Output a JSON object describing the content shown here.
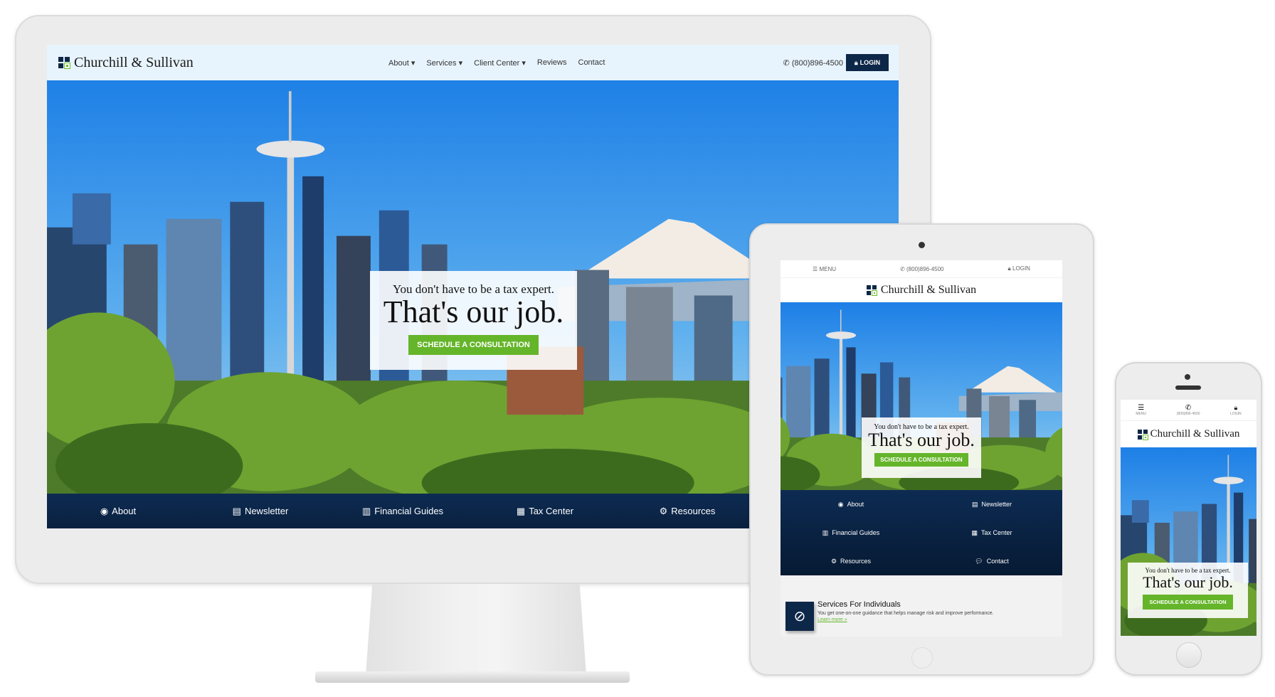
{
  "brand": {
    "name": "Churchill & Sullivan",
    "navy": "#0d2748",
    "green": "#65b52a",
    "header_bg": "#e8f4fd"
  },
  "desktop": {
    "nav": [
      {
        "label": "About",
        "dropdown": true
      },
      {
        "label": "Services",
        "dropdown": true
      },
      {
        "label": "Client Center",
        "dropdown": true
      },
      {
        "label": "Reviews"
      },
      {
        "label": "Contact"
      }
    ],
    "phone": "(800)896-4500",
    "login": "LOGIN",
    "hero": {
      "subtitle": "You don't have to be a tax expert.",
      "headline": "That's our job.",
      "cta": "SCHEDULE A CONSULTATION"
    },
    "bottom_nav": [
      {
        "label": "About",
        "icon": "user-circle-icon"
      },
      {
        "label": "Newsletter",
        "icon": "newspaper-icon"
      },
      {
        "label": "Financial Guides",
        "icon": "bar-chart-icon"
      },
      {
        "label": "Tax Center",
        "icon": "calendar-icon"
      },
      {
        "label": "Resources",
        "icon": "gear-icon"
      }
    ]
  },
  "tablet": {
    "top": {
      "menu": "MENU",
      "phone": "(800)896-4500",
      "login": "LOGIN"
    },
    "hero": {
      "subtitle": "You don't have to be a tax expert.",
      "headline": "That's our job.",
      "cta": "SCHEDULE A CONSULTATION"
    },
    "grid_nav": [
      {
        "label": "About",
        "icon": "user-circle-icon"
      },
      {
        "label": "Newsletter",
        "icon": "newspaper-icon"
      },
      {
        "label": "Financial Guides",
        "icon": "bar-chart-icon"
      },
      {
        "label": "Tax Center",
        "icon": "calendar-icon"
      },
      {
        "label": "Resources",
        "icon": "gear-icon"
      },
      {
        "label": "Contact",
        "icon": "comments-icon"
      }
    ],
    "services": {
      "title": "Services For Individuals",
      "text": "You get one-on-one guidance that helps manage risk and improve performance.",
      "link": "Learn more »",
      "icon": "compass-icon"
    }
  },
  "mobile": {
    "top": {
      "menu": "MENU",
      "phone": "(800)896-4500",
      "login": "LOGIN"
    },
    "hero": {
      "subtitle": "You don't have to be a tax expert.",
      "headline": "That's our job.",
      "cta": "SCHEDULE A CONSULTATION"
    }
  }
}
